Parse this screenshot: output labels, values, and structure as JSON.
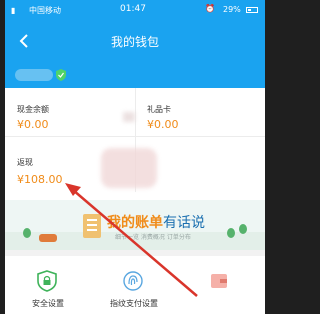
{
  "status_bar": {
    "carrier": "中国移动",
    "time": "01:47",
    "battery": "29%"
  },
  "header": {
    "title": "我的钱包",
    "back_icon": "chevron-left-icon"
  },
  "balances": [
    {
      "label": "现金余额",
      "value": "¥0.00"
    },
    {
      "label": "礼品卡",
      "value": "¥0.00"
    },
    {
      "label": "返现",
      "value": "¥108.00"
    }
  ],
  "banner": {
    "title_part1": "我的账单",
    "title_part2": "有话说",
    "subtitle": "细节一览  消费概况  订单分布"
  },
  "tools": [
    {
      "label": "安全设置",
      "icon": "shield-lock-icon"
    },
    {
      "label": "指纹支付设置",
      "icon": "fingerprint-icon"
    }
  ],
  "colors": {
    "header_blue": "#1aa3f0",
    "accent_orange": "#f08c1a",
    "arrow_red": "#d9352b"
  }
}
